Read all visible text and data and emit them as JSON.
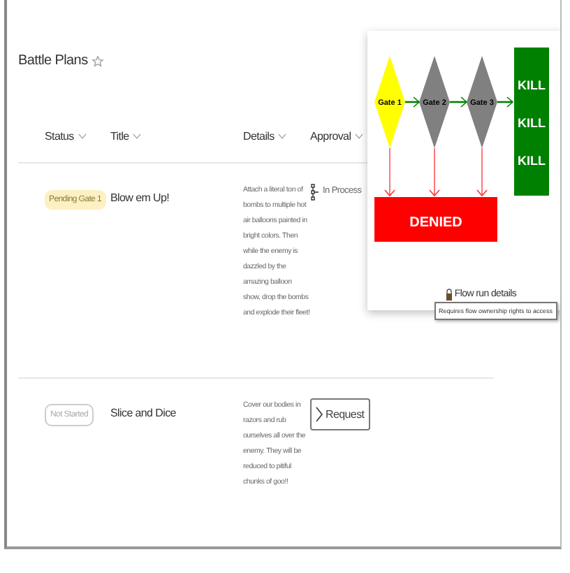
{
  "page": {
    "title": "Battle Plans"
  },
  "table": {
    "columns": [
      "Status",
      "Title",
      "Details",
      "Approval"
    ],
    "rows": [
      {
        "status": {
          "label": "Pending Gate 1",
          "kind": "pending"
        },
        "title": "Blow em Up!",
        "details": "Attach a literal ton of bombs to multiple hot air balloons painted in bright colors. Then while the enemy is dazzled by the amazing balloon show, drop the bombs and explode their fleet!",
        "approval": {
          "kind": "status",
          "label": "In Process"
        }
      },
      {
        "status": {
          "label": "Not Started",
          "kind": "idle"
        },
        "title": "Slice and Dice",
        "details": "Cover our bodies in razors and rub ourselves all over the enemy. They will be reduced to pitiful chunks of goo!!",
        "approval": {
          "kind": "button",
          "label": "Request"
        }
      }
    ]
  },
  "popup": {
    "gates": [
      {
        "label": "Gate 1",
        "color": "#ffff00"
      },
      {
        "label": "Gate 2",
        "color": "#808080"
      },
      {
        "label": "Gate 3",
        "color": "#808080"
      }
    ],
    "success": {
      "lines": [
        "KILL",
        "KILL",
        "KILL"
      ]
    },
    "failure": {
      "label": "DENIED"
    },
    "link": "Flow run details",
    "tooltip": "Requires flow ownership rights to access"
  }
}
